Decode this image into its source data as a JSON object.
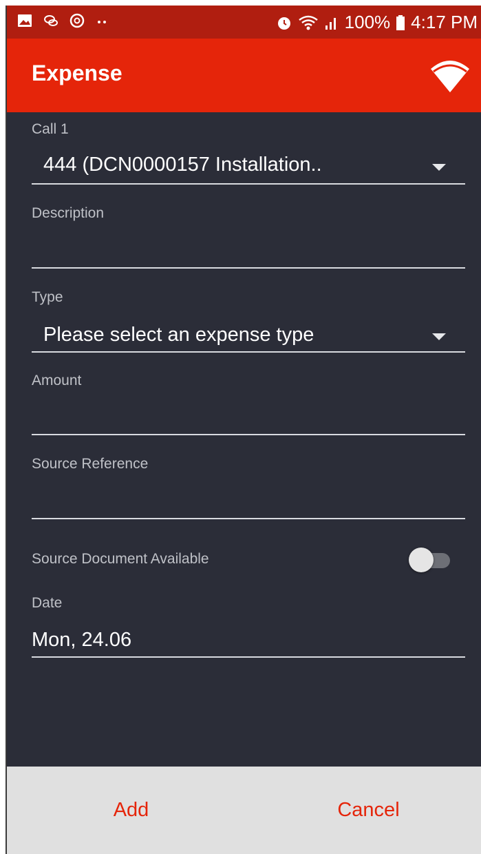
{
  "status_bar": {
    "left_icons": [
      "gallery-icon",
      "chat-icon",
      "sync-icon",
      "more-dots-icon"
    ],
    "alarm_icon": "alarm-icon",
    "wifi_icon": "wifi-status-icon",
    "signal_icon": "signal-icon",
    "battery": "100%",
    "battery_icon": "battery-icon",
    "time": "4:17 PM"
  },
  "app_bar": {
    "title": "Expense",
    "connection_icon": "wifi-connection-icon"
  },
  "form": {
    "call": {
      "label": "Call 1",
      "value": "444 (DCN0000157 Installation.."
    },
    "description": {
      "label": "Description",
      "value": ""
    },
    "type": {
      "label": "Type",
      "value": "Please select an expense type"
    },
    "amount": {
      "label": "Amount",
      "value": ""
    },
    "source_reference": {
      "label": "Source Reference",
      "value": ""
    },
    "source_document": {
      "label": "Source Document Available",
      "enabled": false
    },
    "date": {
      "label": "Date",
      "value": "Mon, 24.06"
    }
  },
  "actions": {
    "add_label": "Add",
    "cancel_label": "Cancel"
  },
  "colors": {
    "status_bar": "#b01e10",
    "app_bar": "#e5250a",
    "background": "#2b2d38",
    "bottom_bar": "#e0e0e0",
    "accent": "#e5250a"
  }
}
